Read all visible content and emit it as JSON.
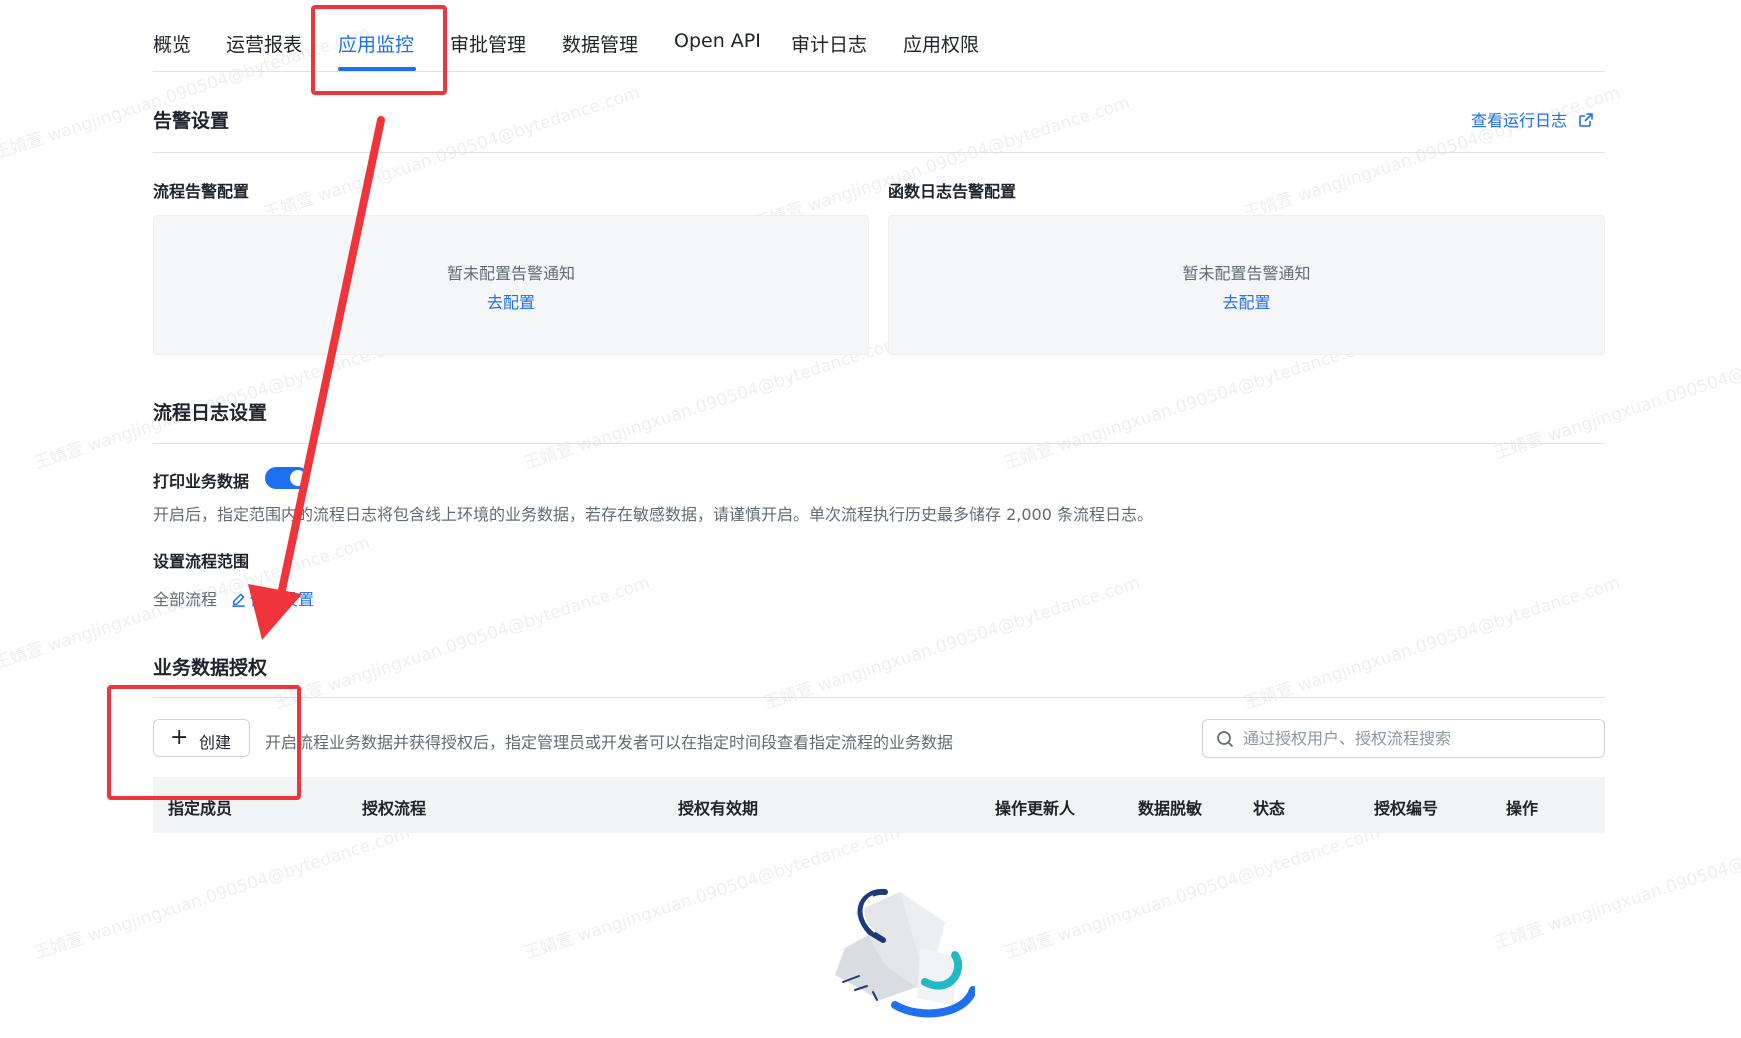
{
  "tabs": [
    {
      "label": "概览",
      "active": false
    },
    {
      "label": "运营报表",
      "active": false
    },
    {
      "label": "应用监控",
      "active": true
    },
    {
      "label": "审批管理",
      "active": false
    },
    {
      "label": "数据管理",
      "active": false
    },
    {
      "label": "Open API",
      "active": false
    },
    {
      "label": "审计日志",
      "active": false
    },
    {
      "label": "应用权限",
      "active": false
    }
  ],
  "alert": {
    "title": "告警设置",
    "view_logs_link": "查看运行日志",
    "flow": {
      "title": "流程告警配置",
      "empty_text": "暂未配置告警通知",
      "config_link": "去配置"
    },
    "function": {
      "title": "函数日志告警配置",
      "empty_text": "暂未配置告警通知",
      "config_link": "去配置"
    }
  },
  "flow_log": {
    "title": "流程日志设置",
    "print_label": "打印业务数据",
    "print_enabled": true,
    "print_desc": "开启后，指定范围内的流程日志将包含线上环境的业务数据，若存在敏感数据，请谨慎开启。单次流程执行历史最多储存 2,000 条流程日志。",
    "scope_label": "设置流程范围",
    "scope_value": "全部流程",
    "edit_link": "修改设置"
  },
  "auth": {
    "title": "业务数据授权",
    "create_label": "创建",
    "desc": "开启流程业务数据并获得授权后，指定管理员或开发者可以在指定时间段查看指定流程的业务数据",
    "search_placeholder": "通过授权用户、授权流程搜索",
    "columns": [
      "指定成员",
      "授权流程",
      "授权有效期",
      "操作更新人",
      "数据脱敏",
      "状态",
      "授权编号",
      "操作"
    ]
  },
  "watermark_text": "王婧萱 wangjingxuan.090504@bytedance.com",
  "colors": {
    "accent": "#1f6ff1",
    "annotation": "#f0343b",
    "text": "#1f2329",
    "muted": "#646a73"
  }
}
